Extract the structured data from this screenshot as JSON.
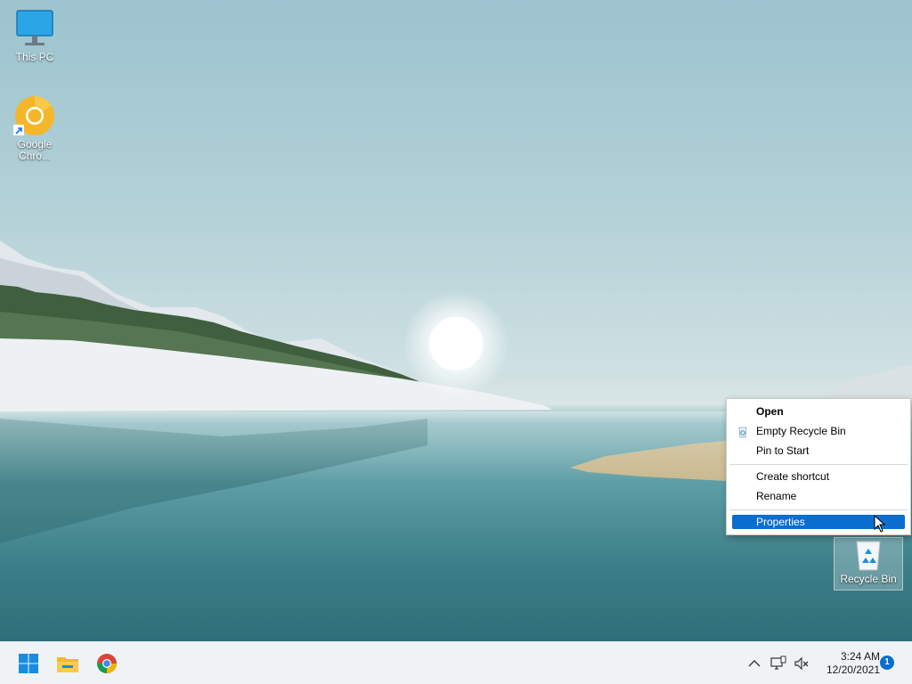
{
  "desktop": {
    "icons": [
      {
        "label": "This PC"
      },
      {
        "label": "Google Chro..."
      },
      {
        "label": "Recycle Bin"
      }
    ]
  },
  "context_menu": {
    "items": [
      {
        "label": "Open"
      },
      {
        "label": "Empty Recycle Bin"
      },
      {
        "label": "Pin to Start"
      },
      {
        "label": "Create shortcut"
      },
      {
        "label": "Rename"
      },
      {
        "label": "Properties"
      }
    ]
  },
  "taskbar": {
    "pinned": [
      "start-icon",
      "file-explorer-icon",
      "chrome-icon"
    ],
    "tray_icons": [
      "chevron-up-icon",
      "network-icon",
      "volume-muted-icon"
    ],
    "time": "3:24 AM",
    "date": "12/20/2021",
    "notification_count": "1"
  },
  "colors": {
    "accent": "#0a6ed1",
    "taskbar_bg": "#f0f3f6"
  }
}
